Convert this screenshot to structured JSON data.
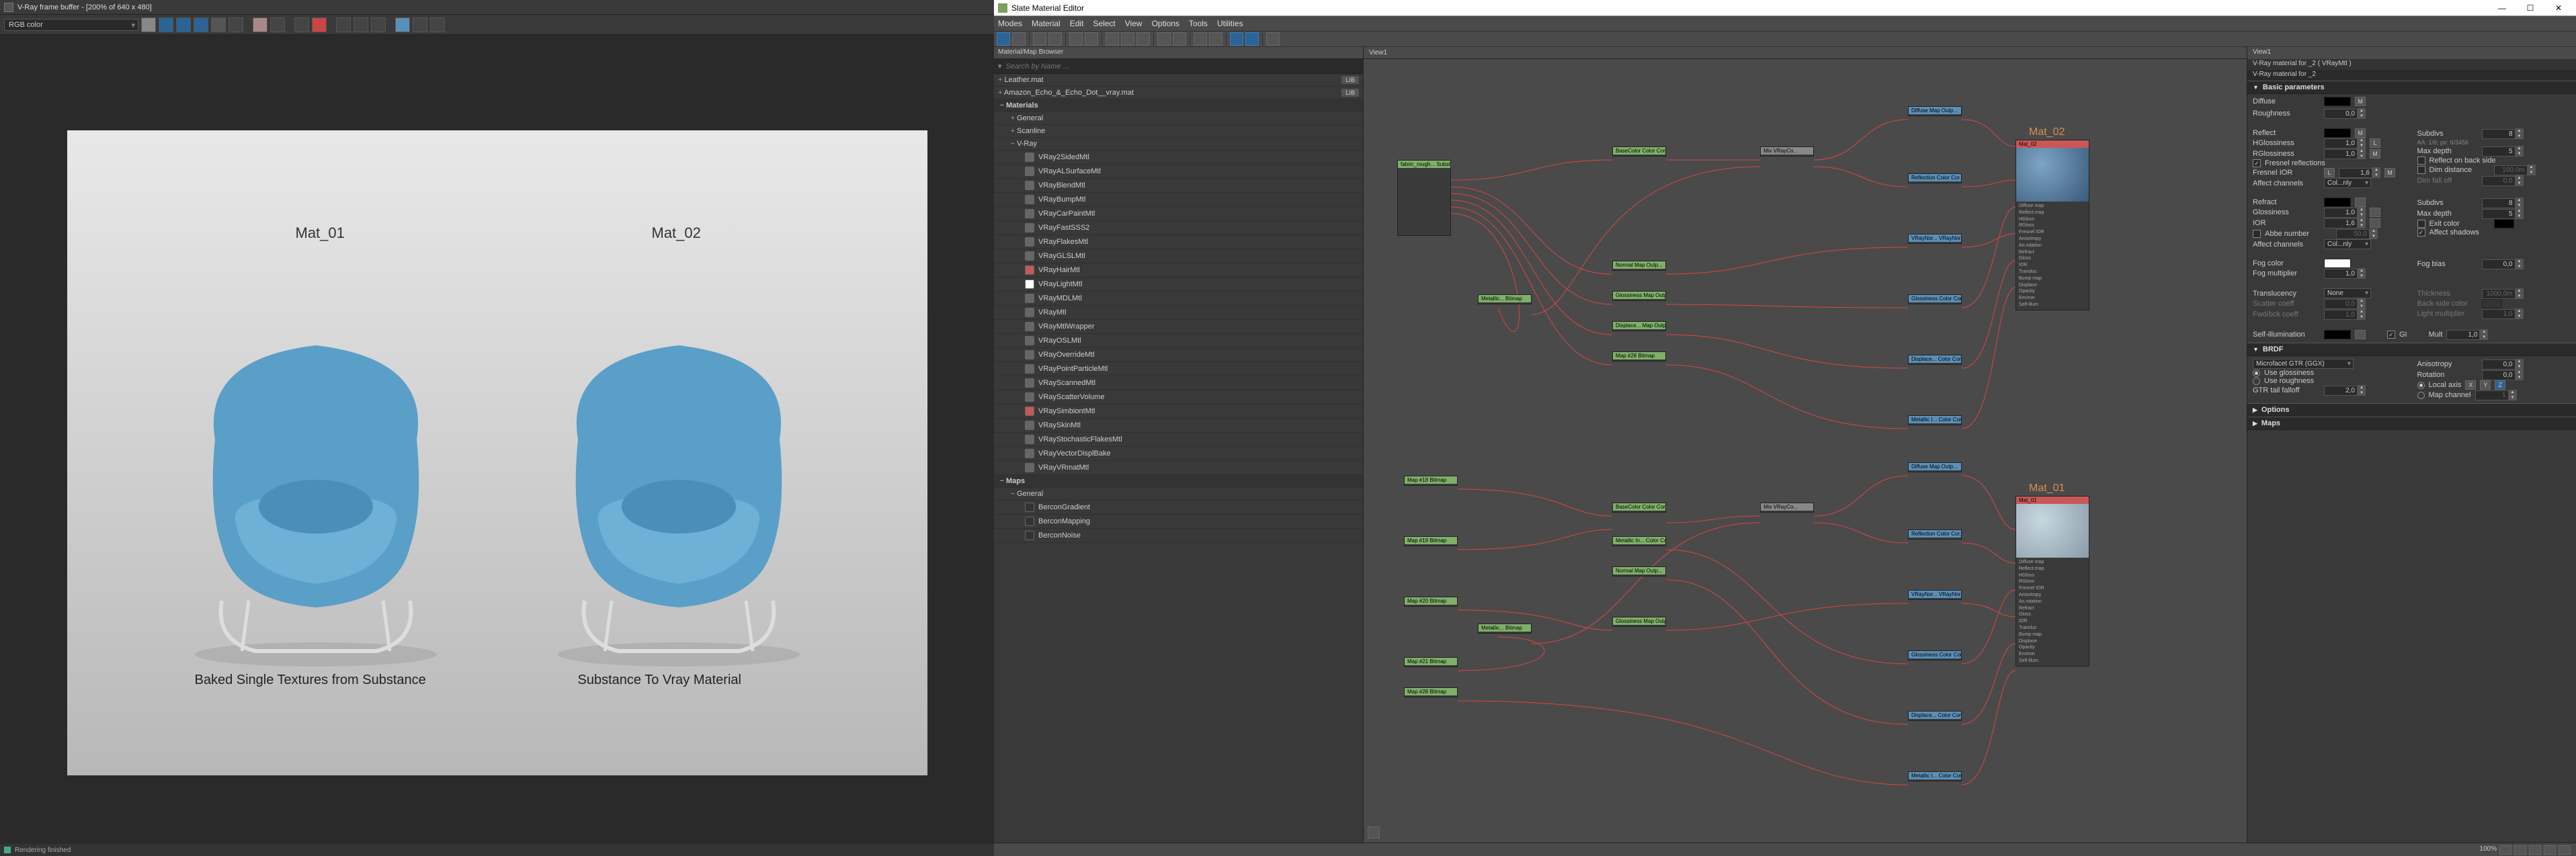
{
  "vfb": {
    "title": "V-Ray frame buffer - [200% of 640 x 480]",
    "colorMode": "RGB color",
    "render": {
      "mat01_label": "Mat_01",
      "mat02_label": "Mat_02",
      "caption1": "Baked Single Textures from Substance",
      "caption2": "Substance To Vray Material"
    },
    "status": "Rendering finished"
  },
  "sme": {
    "title": "Slate Material Editor",
    "menus": [
      "Modes",
      "Material",
      "Edit",
      "Select",
      "View",
      "Options",
      "Tools",
      "Utilities"
    ],
    "browser": {
      "header": "Material/Map Browser",
      "searchPlaceholder": "Search by Name ...",
      "libs": [
        {
          "label": "Leather.mat",
          "badge": "LIB"
        },
        {
          "label": "Amazon_Echo_&_Echo_Dot__vray.mat",
          "badge": "LIB"
        }
      ],
      "sections": {
        "materials": "Materials",
        "general": "General",
        "scanline": "Scanline",
        "vray": "V-Ray",
        "maps": "Maps",
        "mapsGeneral": "General"
      },
      "vrayMaterials": [
        "VRay2SidedMtl",
        "VRayALSurfaceMtl",
        "VRayBlendMtl",
        "VRayBumpMtl",
        "VRayCarPaintMtl",
        "VRayFastSSS2",
        "VRayFlakesMtl",
        "VRayGLSLMtl",
        "VRayHairMtl",
        "VRayLightMtl",
        "VRayMDLMtl",
        "VRayMtl",
        "VRayMtlWrapper",
        "VRayOSLMtl",
        "VRayOverrideMtl",
        "VRayPointParticleMtl",
        "VRayScannedMtl",
        "VRayScatterVolume",
        "VRaySimbiontMtl",
        "VRaySkinMtl",
        "VRayStochasticFlakesMtl",
        "VRayVectorDisplBake",
        "VRayVRmatMtl"
      ],
      "mapItems": [
        "BerconGradient",
        "BerconMapping",
        "BerconNoise"
      ]
    },
    "graph": {
      "tab": "View1",
      "mat02_title": "Mat_02",
      "mat01_title": "Mat_01",
      "outputSlots": [
        "Diffuse map",
        "Reflect.map",
        "HGloss",
        "RGloss",
        "Fresnel IOR",
        "Anisotropy",
        "An.rotation",
        "Refract",
        "Gloss",
        "IOR",
        "Transluc",
        "Bump map",
        "Displace",
        "Opacity",
        "Environ",
        "Self-illum"
      ],
      "nodes": {
        "substance": "fabric_rough...\nSubstance2",
        "basecolor": "BaseColor\nColor Cor...",
        "mix": "Mix\nVRayCo...",
        "metallic": "Metallic...\nBitmap",
        "metallic_cc": "Metallic In...\nColor Cor...",
        "normal": "Normal\nMap Outp...",
        "normal_bump": "VRayNor...\nVRayNor...",
        "glossiness": "Glossiness\nMap Outp...",
        "gloss_cc": "Glossiness\nColor Cor...",
        "displace": "Displace...\nMap Outp...",
        "displace_cc": "Displace...\nColor Cor...",
        "metallic_inv": "Metallic I...\nColor Cor...",
        "height": "Map #28\nBitmap",
        "map18": "Map #18\nBitmap",
        "map19": "Map #19\nBitmap",
        "map20": "Map #20\nBitmap",
        "map21": "Map #21\nBitmap",
        "diffuse": "Diffuse\nMap Outp...",
        "reflection": "Reflection\nColor Cor..."
      }
    },
    "params": {
      "viewTab": "View1",
      "hdr1": "V-Ray material for _2 ( VRayMtl )",
      "hdr2": "V-Ray material for _2",
      "sections": {
        "basic": "Basic parameters",
        "brdf": "BRDF",
        "options": "Options",
        "maps": "Maps"
      },
      "labels": {
        "diffuse": "Diffuse",
        "roughness": "Roughness",
        "reflect": "Reflect",
        "hgloss": "HGlossiness",
        "rgloss": "RGlossiness",
        "fresnel": "Fresnel reflections",
        "fresnelIOR": "Fresnel IOR",
        "affectCh": "Affect channels",
        "subdivs": "Subdivs",
        "aa": "AA: 1/6; px: 6/3456",
        "maxDepth": "Max depth",
        "reflectBack": "Reflect on back side",
        "dimDistance": "Dim distance",
        "dimFalloff": "Dim fall off",
        "refract": "Refract",
        "glossiness": "Glossiness",
        "ior": "IOR",
        "abbe": "Abbe number",
        "exitColor": "Exit color",
        "affectShadows": "Affect shadows",
        "fogColor": "Fog color",
        "fogMult": "Fog multiplier",
        "fogBias": "Fog bias",
        "translucency": "Translucency",
        "thickness": "Thickness",
        "scatterCoeff": "Scatter coeff",
        "backSideColor": "Back-side color",
        "fwdBckCoeff": "Fwd/bck coeff",
        "lightMult": "Light multiplier",
        "selfIllum": "Self-illumination",
        "gi": "GI",
        "mult": "Mult",
        "useGloss": "Use glossiness",
        "useRough": "Use roughness",
        "anisotropy": "Anisotropy",
        "rotation": "Rotation",
        "localAxis": "Local axis",
        "mapChannel": "Map channel",
        "gtrTail": "GTR tail falloff"
      },
      "values": {
        "roughness": "0,0",
        "hgloss": "1,0",
        "rgloss": "1,0",
        "fresnelIOR": "1,6",
        "subdivs": "8",
        "maxDepth": "5",
        "dimDistance": "100,0m",
        "dimFalloff": "0,0",
        "glossiness": "1,0",
        "ior": "1,6",
        "refrMaxDepth": "5",
        "abbe": "50,0",
        "fogMult": "1,0",
        "fogBias": "0,0",
        "thickness": "1000,0m",
        "scatterCoeff": "0,0",
        "fwdBckCoeff": "1,0",
        "lightMult": "1,0",
        "selfMult": "1,0",
        "aniso": "0,0",
        "rotation": "0,0",
        "gtr": "2,0",
        "mapCh": "1",
        "affectCh": "Col...nly",
        "translucency": "None",
        "brdfType": "Microfacet GTR (GGX)"
      },
      "axes": {
        "x": "X",
        "y": "Y",
        "z": "Z"
      }
    },
    "status": {
      "zoom": "100%"
    }
  }
}
